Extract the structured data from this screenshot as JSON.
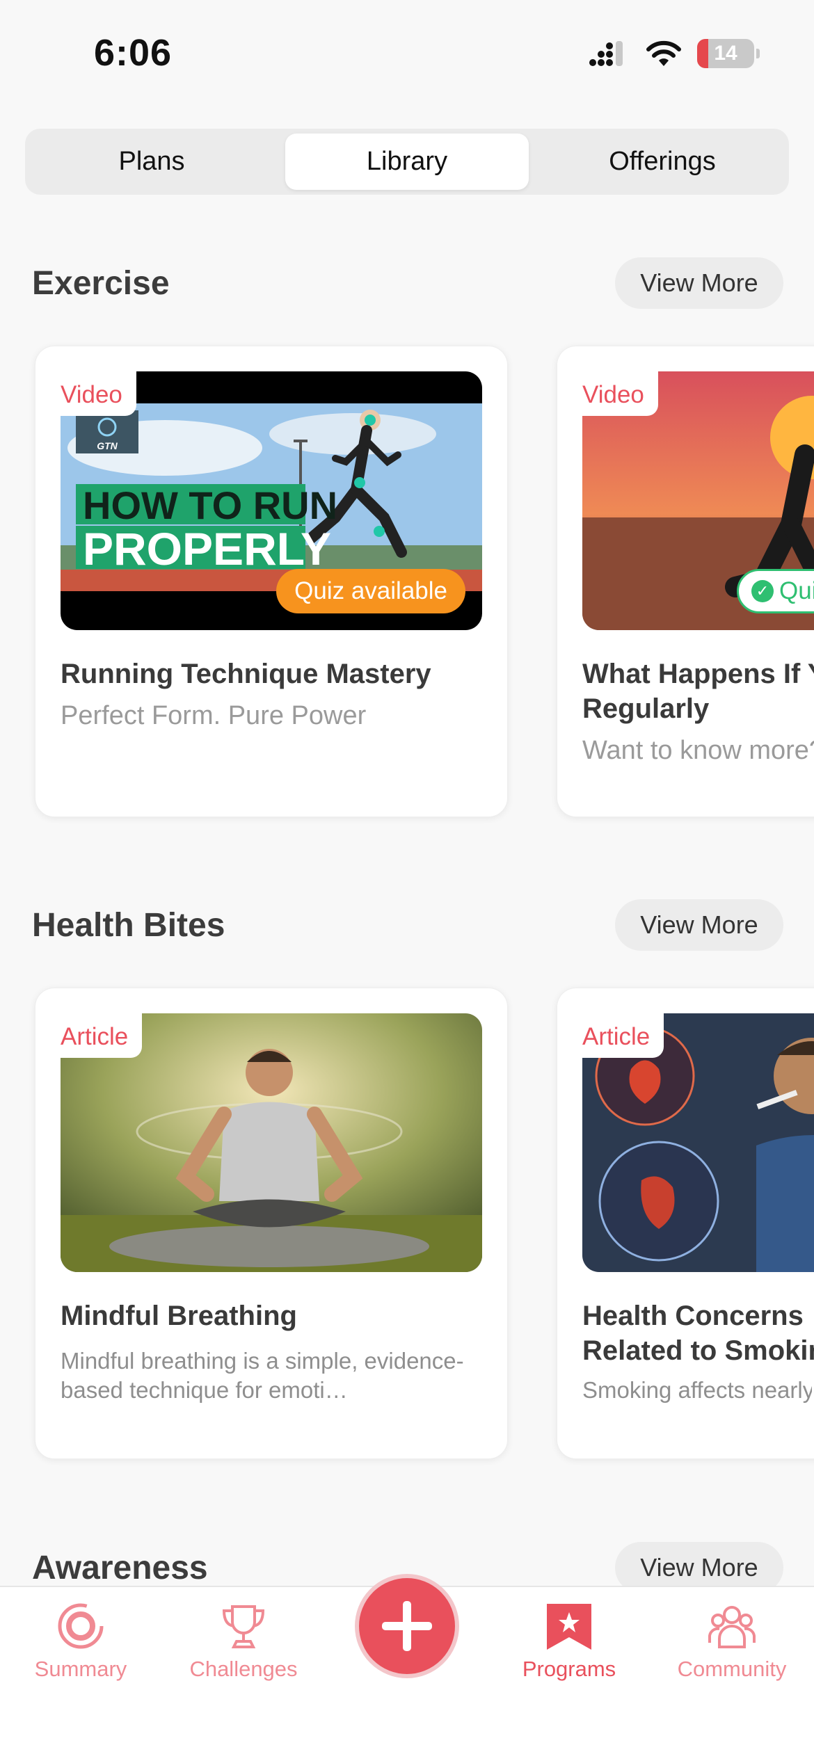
{
  "status_bar": {
    "time": "6:06",
    "battery": "14"
  },
  "segments": [
    "Plans",
    "Library",
    "Offerings"
  ],
  "active_segment": "Library",
  "sections": [
    {
      "title": "Exercise",
      "view_more": "View More",
      "cards": [
        {
          "tag": "Video",
          "title": "Running Technique Mastery",
          "subtitle": "Perfect Form. Pure Power",
          "quiz": "Quiz available",
          "thumb_text": [
            "HOW TO RUN",
            "PROPERLY"
          ],
          "thumb_logo": "GTN"
        },
        {
          "tag": "Video",
          "title": "What Happens If You Exercise Regularly",
          "subtitle": "Want to know more?",
          "quiz": "Quiz"
        }
      ]
    },
    {
      "title": "Health Bites",
      "view_more": "View More",
      "cards": [
        {
          "tag": "Article",
          "title": "Mindful Breathing",
          "description": "Mindful breathing is a simple, evidence-based technique for emoti…"
        },
        {
          "tag": "Article",
          "title": "Health Concerns Related to Smoking",
          "description": "Smoking affects nearly every organ in the body, often long before"
        }
      ]
    },
    {
      "title": "Awareness",
      "view_more": "View More"
    }
  ],
  "tab_bar": {
    "items": [
      {
        "label": "Summary",
        "icon": "summary-ring-icon"
      },
      {
        "label": "Challenges",
        "icon": "trophy-icon"
      },
      {
        "label": "Programs",
        "icon": "bookmark-star-icon",
        "active": true
      },
      {
        "label": "Community",
        "icon": "people-icon"
      }
    ],
    "fab_icon": "plus-icon"
  },
  "colors": {
    "accent": "#e9505c",
    "quiz_orange": "#f7931e",
    "quiz_done_green": "#2fbf71",
    "background": "#f8f8f8"
  }
}
